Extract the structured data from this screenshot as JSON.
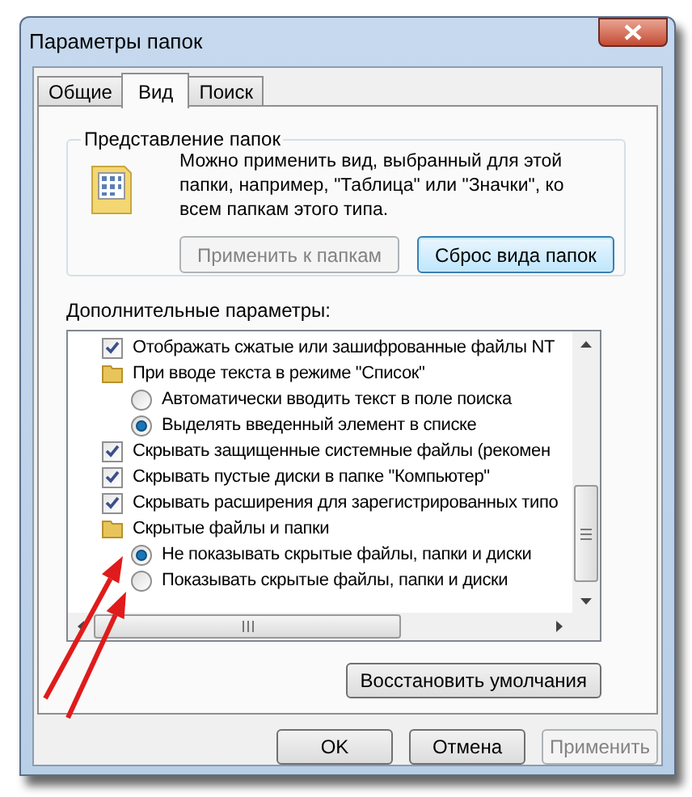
{
  "window": {
    "title": "Параметры папок"
  },
  "tabs": [
    {
      "label": "Общие",
      "selected": false
    },
    {
      "label": "Вид",
      "selected": true
    },
    {
      "label": "Поиск",
      "selected": false
    }
  ],
  "folder_views": {
    "title": "Представление папок",
    "description": "Можно применить вид, выбранный для этой папки, например, \"Таблица\" или \"Значки\", ко всем папкам этого типа.",
    "buttons": [
      {
        "label": "Применить к папкам",
        "disabled": true,
        "focused": false
      },
      {
        "label": "Сброс вида папок",
        "disabled": false,
        "focused": true
      }
    ]
  },
  "advanced": {
    "label": "Дополнительные параметры:",
    "items": [
      {
        "kind": "checkbox",
        "label": "Отображать сжатые или зашифрованные файлы NT",
        "checked": true
      },
      {
        "kind": "group",
        "label": "При вводе текста в режиме \"Список\"",
        "children": [
          {
            "kind": "radio",
            "label": "Автоматически вводить текст в поле поиска",
            "selected": false
          },
          {
            "kind": "radio",
            "label": "Выделять введенный элемент в списке",
            "selected": true
          }
        ]
      },
      {
        "kind": "checkbox",
        "label": "Скрывать защищенные системные файлы (рекомен",
        "checked": true
      },
      {
        "kind": "checkbox",
        "label": "Скрывать пустые диски в папке \"Компьютер\"",
        "checked": true
      },
      {
        "kind": "checkbox",
        "label": "Скрывать расширения для зарегистрированных типо",
        "checked": true
      },
      {
        "kind": "group",
        "label": "Скрытые файлы и папки",
        "children": [
          {
            "kind": "radio",
            "label": "Не показывать скрытые файлы, папки и диски",
            "selected": true
          },
          {
            "kind": "radio",
            "label": "Показывать скрытые файлы, папки и диски",
            "selected": false
          }
        ]
      }
    ]
  },
  "restore_button": "Восстановить умолчания",
  "buttons": [
    {
      "label": "OK",
      "disabled": false
    },
    {
      "label": "Отмена",
      "disabled": false
    },
    {
      "label": "Применить",
      "disabled": true
    }
  ]
}
